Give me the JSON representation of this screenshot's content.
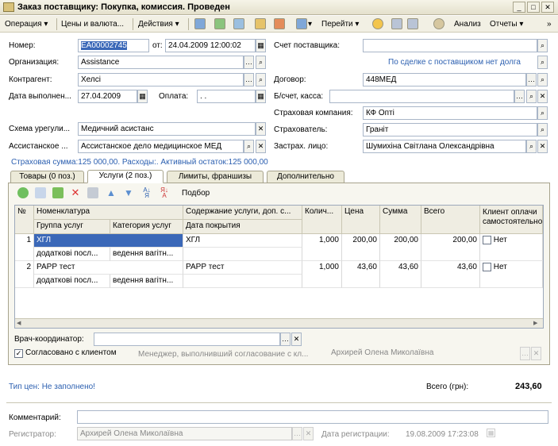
{
  "window": {
    "title": "Заказ поставщику: Покупка, комиссия. Проведен"
  },
  "toolbar": {
    "operation": "Операция",
    "prices": "Цены и валюта...",
    "actions": "Действия",
    "goto": "Перейти",
    "analysis": "Анализ",
    "reports": "Отчеты"
  },
  "header": {
    "number_label": "Номер:",
    "number_value": "ЕА00002745",
    "from_label": "от:",
    "date_value": "24.04.2009 12:00:02",
    "org_label": "Организация:",
    "org_value": "Assistance",
    "contr_label": "Контрагент:",
    "contr_value": "Хелсі",
    "exec_label": "Дата выполнен...",
    "exec_value": "27.04.2009",
    "pay_label": "Оплата:",
    "pay_value": ". .",
    "scheme_label": "Схема урегули...",
    "scheme_value": "Медичний асистанс",
    "assist_label": "Ассистанское ...",
    "assist_value": "Ассистанское дело медицинское МЕД",
    "supplier_inv_label": "Счет поставщика:",
    "supplier_inv_value": "",
    "deal_link": "По сделке с поставщиком нет долга",
    "contract_label": "Договор:",
    "contract_value": "448МЕД",
    "bank_label": "Б/счет, касса:",
    "bank_value": "",
    "ins_company_label": "Страховая компания:",
    "ins_company_value": "КФ Опті",
    "insurer_label": "Страхователь:",
    "insurer_value": "Граніт",
    "insured_label": "Застрах. лицо:",
    "insured_value": "Шумихіна Світлана Олександрівна",
    "summary": "Страховая сумма:125 000,00. Расходы:. Активный остаток:125 000,00"
  },
  "tabs": [
    "Товары (0 поз.)",
    "Услуги (2 поз.)",
    "Лимиты, франшизы",
    "Дополнительно"
  ],
  "grid_toolbar": {
    "select": "Подбор"
  },
  "grid": {
    "headers": {
      "n": "№",
      "nom": "Номенклатура",
      "group": "Группа услуг",
      "cat": "Категория услуг",
      "content": "Содержание услуги, доп. с...",
      "period": "Дата покрытия",
      "qty": "Колич...",
      "price": "Цена",
      "sum": "Сумма",
      "total": "Всего",
      "client1": "Клиент оплачи",
      "client2": "самостоятельно"
    },
    "rows": [
      {
        "n": "1",
        "nom": "ХГЛ",
        "content": "ХГЛ",
        "qty": "1,000",
        "price": "200,00",
        "sum": "200,00",
        "total": "200,00",
        "client": "Нет",
        "group": "додаткові посл...",
        "cat": "ведення вагітн..."
      },
      {
        "n": "2",
        "nom": "РАРР тест",
        "content": "РАРР тест",
        "qty": "1,000",
        "price": "43,60",
        "sum": "43,60",
        "total": "43,60",
        "client": "Нет",
        "group": "додаткові посл...",
        "cat": "ведення вагітн..."
      }
    ]
  },
  "coordinator_label": "Врач-координатор:",
  "coordinator_value": "",
  "agreed_label": "Согласовано с клиентом",
  "agreed_checked": true,
  "manager_label": "Менеджер, выполнивший согласование с кл...",
  "manager_value": "Архирей Олена Миколаївна",
  "price_type_link": "Тип цен: Не заполнено!",
  "total_label": "Всего (грн):",
  "total_value": "243,60",
  "comment_label": "Комментарий:",
  "comment_value": "",
  "registrar_label": "Регистратор:",
  "registrar_value": "Архирей Олена Миколаївна",
  "regdate_label": "Дата регистрации:",
  "regdate_value": "19.08.2009 17:23:08"
}
